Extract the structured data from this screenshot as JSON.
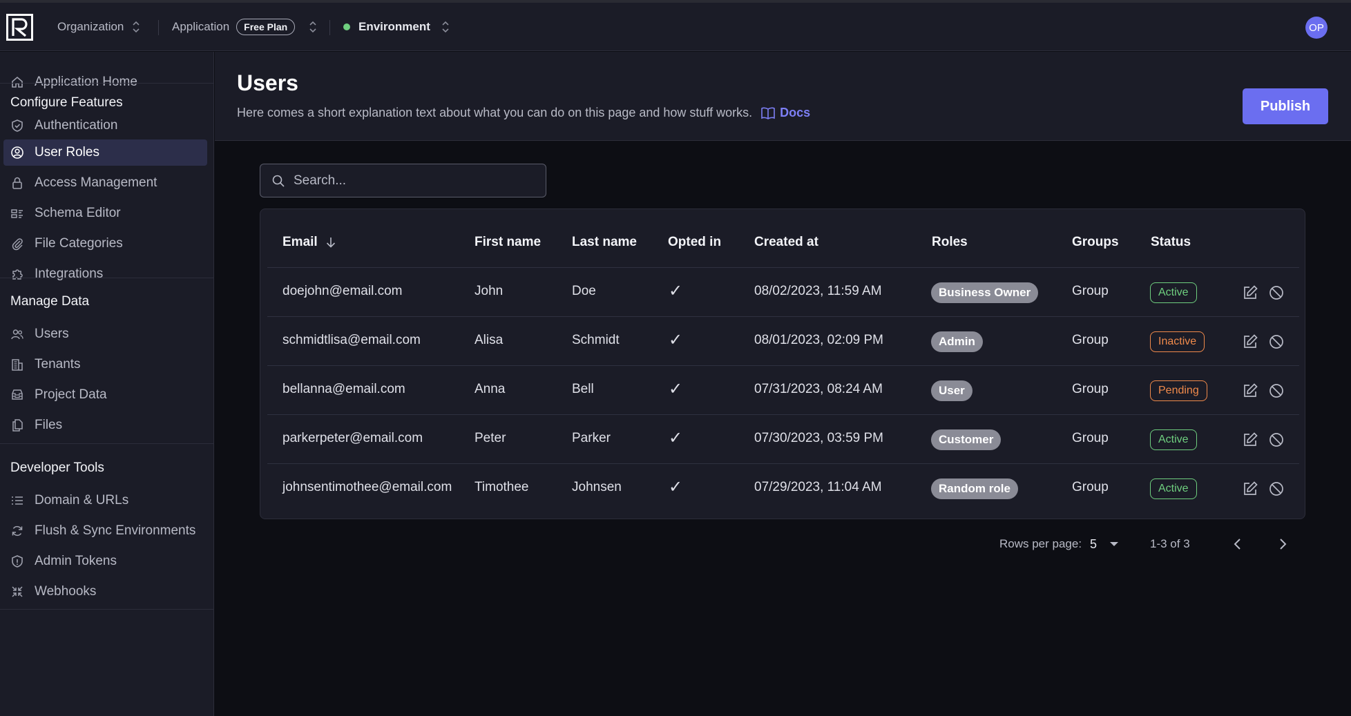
{
  "topbar": {
    "organization": "Organization",
    "application": "Application",
    "plan": "Free Plan",
    "environment": "Environment",
    "avatar_initials": "OP"
  },
  "sidebar": {
    "home": "Application Home",
    "sections": [
      {
        "heading": "Configure Features",
        "items": [
          "Authentication",
          "User Roles",
          "Access Management",
          "Schema Editor",
          "File Categories",
          "Integrations"
        ]
      },
      {
        "heading": "Manage Data",
        "items": [
          "Users",
          "Tenants",
          "Project Data",
          "Files"
        ]
      },
      {
        "heading": "Developer Tools",
        "items": [
          "Domain & URLs",
          "Flush & Sync Environments",
          "Admin Tokens",
          "Webhooks"
        ]
      }
    ],
    "active_item": "User Roles"
  },
  "header": {
    "title": "Users",
    "description": "Here comes a short explanation text about what you can do on this page and how stuff works.",
    "docs_label": "Docs",
    "publish_label": "Publish"
  },
  "search": {
    "placeholder": "Search..."
  },
  "table": {
    "columns": [
      "Email",
      "First name",
      "Last name",
      "Opted in",
      "Created at",
      "Roles",
      "Groups",
      "Status"
    ],
    "sort_column": "Email",
    "rows": [
      {
        "email": "doejohn@email.com",
        "first": "John",
        "last": "Doe",
        "opted_in": "✓",
        "created": "08/02/2023, 11:59 AM",
        "role": "Business Owner",
        "group": "Group",
        "status": "Active"
      },
      {
        "email": "schmidtlisa@email.com",
        "first": "Alisa",
        "last": "Schmidt",
        "opted_in": "✓",
        "created": "08/01/2023, 02:09 PM",
        "role": "Admin",
        "group": "Group",
        "status": "Inactive"
      },
      {
        "email": "bellanna@email.com",
        "first": "Anna",
        "last": "Bell",
        "opted_in": "✓",
        "created": "07/31/2023, 08:24 AM",
        "role": "User",
        "group": "Group",
        "status": "Pending"
      },
      {
        "email": "parkerpeter@email.com",
        "first": "Peter",
        "last": "Parker",
        "opted_in": "✓",
        "created": "07/30/2023, 03:59 PM",
        "role": "Customer",
        "group": "Group",
        "status": "Active"
      },
      {
        "email": "johnsentimothee@email.com",
        "first": "Timothee",
        "last": "Johnsen",
        "opted_in": "✓",
        "created": "07/29/2023, 11:04 AM",
        "role": "Random role",
        "group": "Group",
        "status": "Active"
      }
    ]
  },
  "pagination": {
    "rows_per_page_label": "Rows per page:",
    "rows_per_page": "5",
    "range": "1-3 of 3"
  },
  "colors": {
    "accent": "#6b6ef0",
    "active": "#6fcf7f",
    "warning": "#f08a4b",
    "panel": "#1b1c27",
    "background": "#0d0e14"
  }
}
